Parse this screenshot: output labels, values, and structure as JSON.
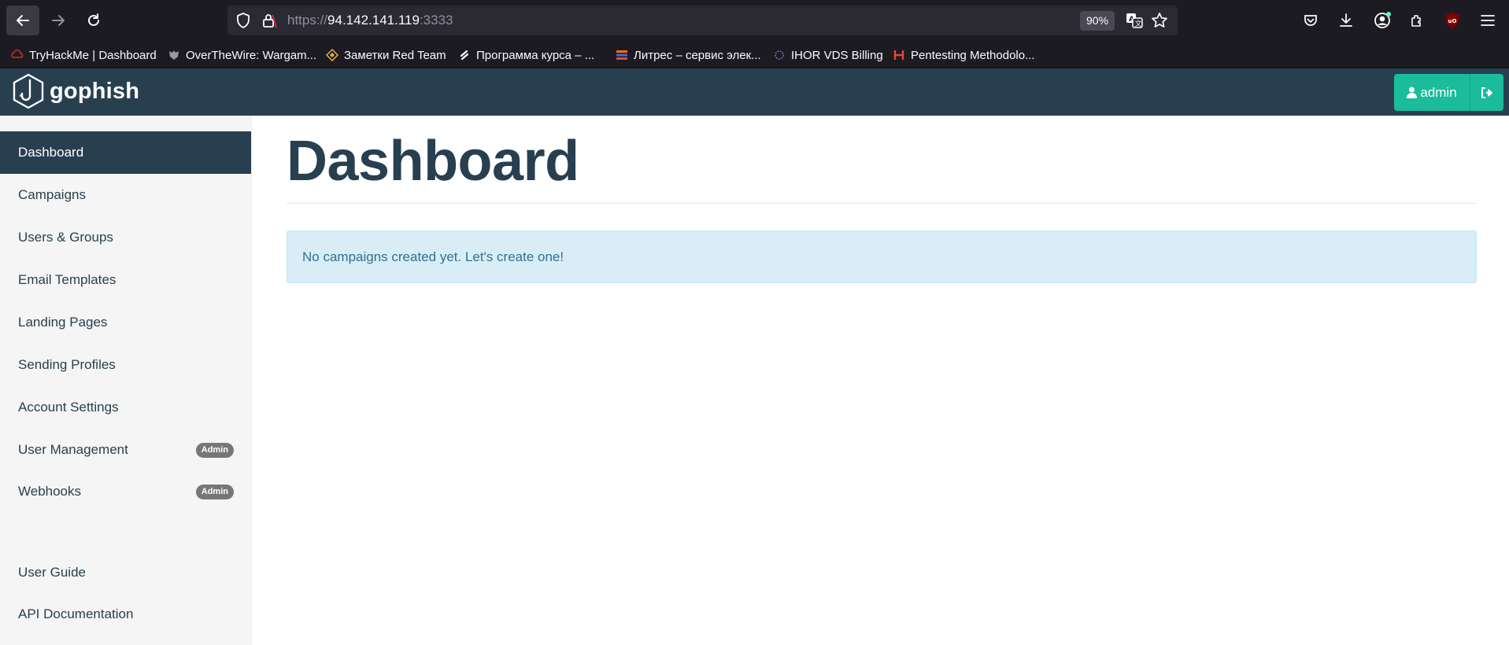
{
  "browser": {
    "url_prefix": "https://",
    "url_host": "94.142.141.119",
    "url_port": ":3333",
    "zoom": "90%",
    "bookmarks": [
      {
        "label": "TryHackMe | Dashboard",
        "icon": "tryhackme-icon"
      },
      {
        "label": "OverTheWire: Wargam...",
        "icon": "overthewire-icon"
      },
      {
        "label": "Заметки Red Team",
        "icon": "redteam-notes-icon"
      },
      {
        "label": "Программа курса – ...",
        "icon": "course-icon"
      },
      {
        "label": "Литрес – сервис элек...",
        "icon": "litres-icon"
      },
      {
        "label": "IHOR VDS Billing",
        "icon": "ihor-icon"
      },
      {
        "label": "Pentesting Methodolo...",
        "icon": "hacktricks-icon"
      }
    ]
  },
  "app": {
    "brand": "gophish",
    "user_label": "admin"
  },
  "sidebar": {
    "items": [
      {
        "label": "Dashboard",
        "active": true
      },
      {
        "label": "Campaigns"
      },
      {
        "label": "Users & Groups"
      },
      {
        "label": "Email Templates"
      },
      {
        "label": "Landing Pages"
      },
      {
        "label": "Sending Profiles"
      },
      {
        "label": "Account Settings"
      },
      {
        "label": "User Management",
        "badge": "Admin"
      },
      {
        "label": "Webhooks",
        "badge": "Admin"
      }
    ],
    "footer_items": [
      {
        "label": "User Guide"
      },
      {
        "label": "API Documentation"
      }
    ]
  },
  "main": {
    "title": "Dashboard",
    "empty_message": "No campaigns created yet. Let's create one!"
  },
  "colors": {
    "navbar": "#283f50",
    "accent": "#1abc9c",
    "alert_bg": "#d9edf7",
    "alert_text": "#31708f"
  }
}
